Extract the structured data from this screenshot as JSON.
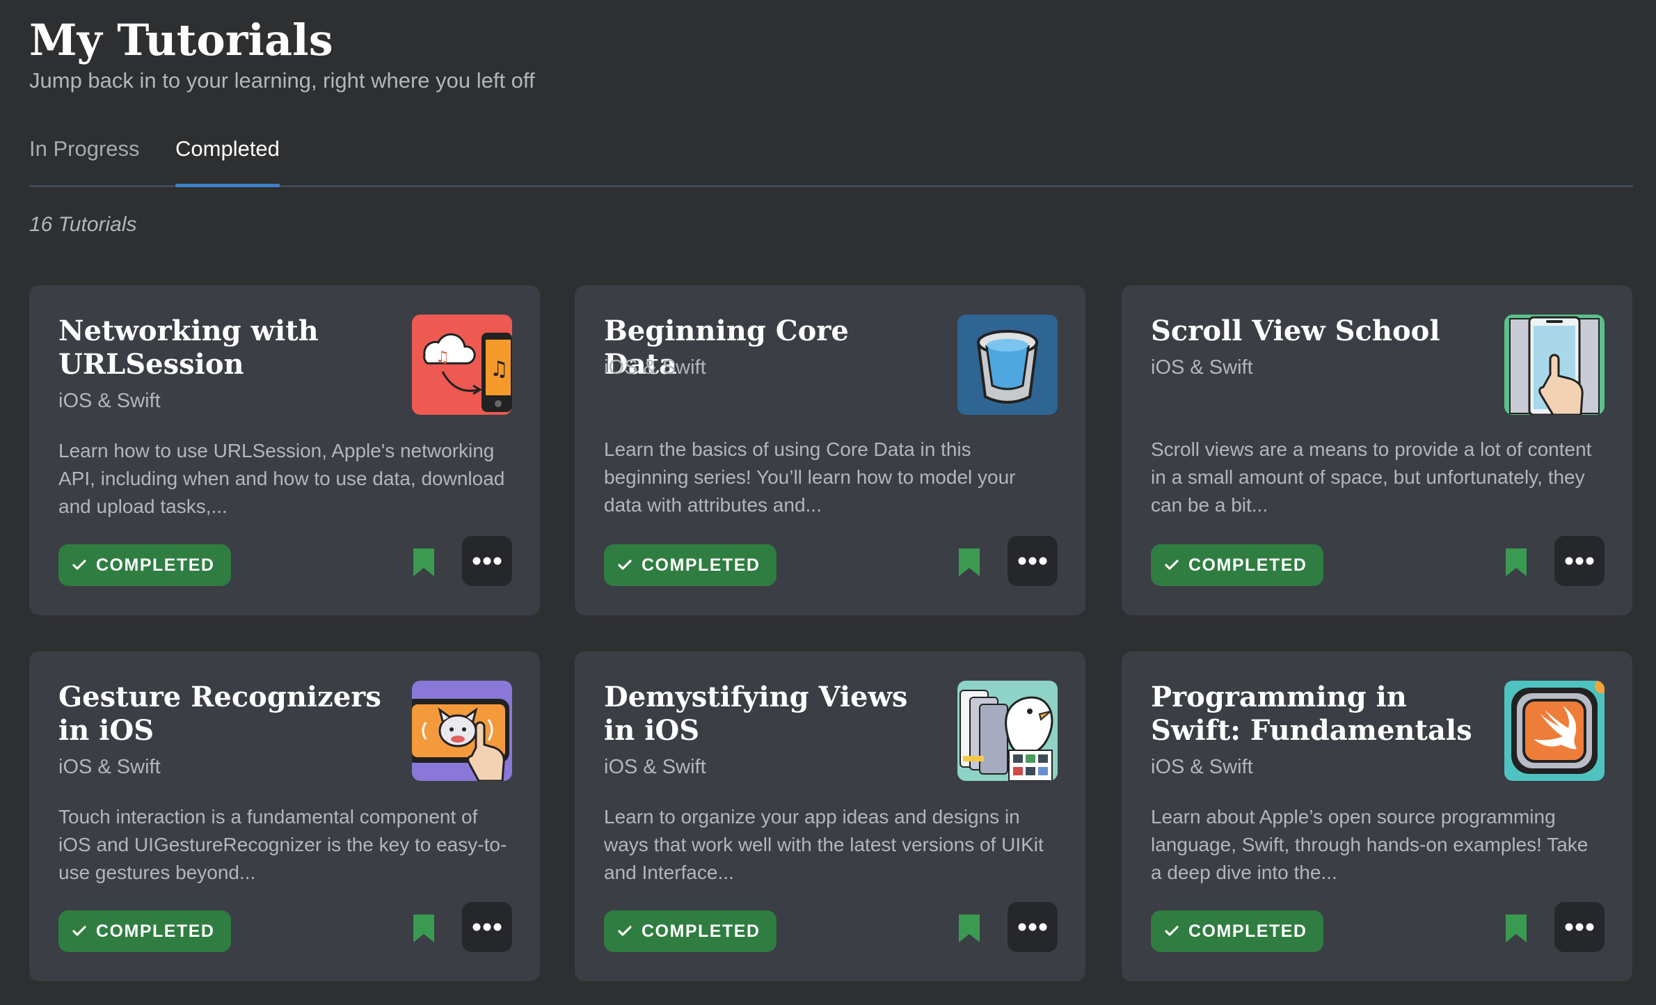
{
  "header": {
    "title": "My Tutorials",
    "subtitle": "Jump back in to your learning, right where you left off"
  },
  "tabs": [
    {
      "label": "In Progress",
      "active": false
    },
    {
      "label": "Completed",
      "active": true
    }
  ],
  "count_label": "16 Tutorials",
  "colors": {
    "accent": "#3d7fc7",
    "completed": "#2f7d41",
    "bookmark": "#3a9a52",
    "card": "#3b3e44",
    "background": "#2e2f31"
  },
  "cards": [
    {
      "title": "Networking with URLSession",
      "subtitle": "iOS & Swift",
      "description": "Learn how to use URLSession, Apple's networking API, including when and how to use data, download and upload tasks,...",
      "status": "COMPLETED",
      "thumbnail_icon": "cloud-music-phone-icon"
    },
    {
      "title": "Beginning Core Data",
      "subtitle": "iOS & Swift",
      "description": "Learn the basics of using Core Data in this beginning series! You’ll learn how to model your data with attributes and...",
      "status": "COMPLETED",
      "thumbnail_icon": "database-bucket-icon"
    },
    {
      "title": "Scroll View School",
      "subtitle": "iOS & Swift",
      "description": "Scroll views are a means to provide a lot of content in a small amount of space, but unfortunately, they can be a bit...",
      "status": "COMPLETED",
      "thumbnail_icon": "phone-swipe-hand-icon"
    },
    {
      "title": "Gesture Recognizers in iOS",
      "subtitle": "iOS & Swift",
      "description": "Touch interaction is a fundamental component of iOS and UIGestureRecognizer is the key to easy-to-use gestures beyond...",
      "status": "COMPLETED",
      "thumbnail_icon": "cat-touch-hand-icon"
    },
    {
      "title": "Demystifying Views in iOS",
      "subtitle": "iOS & Swift",
      "description": "Learn to organize your app ideas and designs in ways that work well with the latest versions of UIKit and Interface...",
      "status": "COMPLETED",
      "thumbnail_icon": "stacked-phones-bird-icon"
    },
    {
      "title": "Programming in Swift: Fundamentals",
      "subtitle": "iOS & Swift",
      "description": "Learn about Apple’s open source programming language, Swift, through hands-on examples! Take a deep dive into the...",
      "status": "COMPLETED",
      "thumbnail_icon": "swift-logo-icon"
    }
  ]
}
